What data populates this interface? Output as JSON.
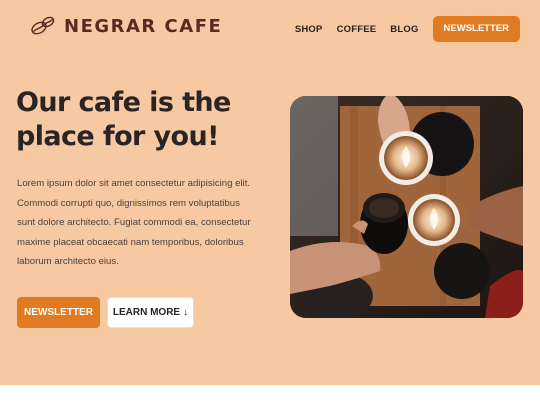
{
  "brand": {
    "name": "NEGRAR CAFE",
    "logo_icon": "coffee-beans-icon"
  },
  "nav": {
    "links": [
      "SHOP",
      "COFFEE",
      "BLOG"
    ],
    "cta": "NEWSLETTER"
  },
  "hero": {
    "title": "Our cafe is the place for you!",
    "text": "Lorem ipsum dolor sit amet consectetur adipisicing elit. Commodi corrupti quo, dignissimos rem voluptatibus sunt dolore architecto. Fugiat commodi ea, consectetur maxime placeat obcaecati nam temporibus, doloribus laborum architecto eius.",
    "primary_button": "NEWSLETTER",
    "secondary_button": "LEARN MORE",
    "secondary_icon": "↓",
    "image_icon": "coffee-cheers-photo"
  },
  "colors": {
    "background": "#f6c9a2",
    "accent": "#e07b22",
    "brand": "#5a2a22",
    "text": "#2b2424"
  }
}
